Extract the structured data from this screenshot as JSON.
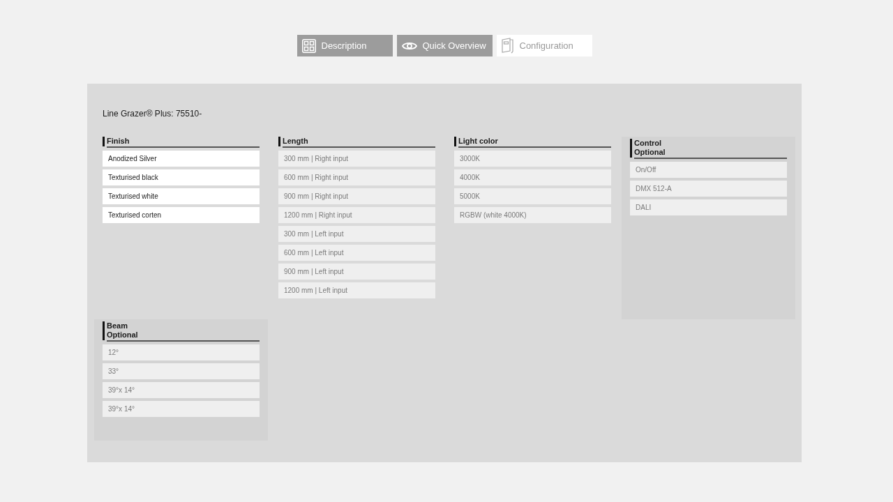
{
  "tabs": [
    {
      "label": "Description",
      "selected": false
    },
    {
      "label": "Quick Overview",
      "selected": false
    },
    {
      "label": "Configuration",
      "selected": true
    }
  ],
  "configurator": {
    "title": "Line Grazer® Plus: 75510-",
    "groups": [
      {
        "title": "Finish",
        "optional": false,
        "options": [
          {
            "label": "Anodized Silver",
            "disabled": false
          },
          {
            "label": "Texturised black",
            "disabled": false
          },
          {
            "label": "Texturised white",
            "disabled": false
          },
          {
            "label": "Texturised corten",
            "disabled": false
          }
        ]
      },
      {
        "title": "Length",
        "optional": false,
        "options": [
          {
            "label": "300 mm | Right input",
            "disabled": true
          },
          {
            "label": "600 mm | Right input",
            "disabled": true
          },
          {
            "label": "900 mm | Right input",
            "disabled": true
          },
          {
            "label": "1200 mm | Right input",
            "disabled": true
          },
          {
            "label": "300 mm | Left input",
            "disabled": true
          },
          {
            "label": "600 mm | Left input",
            "disabled": true
          },
          {
            "label": "900 mm | Left input",
            "disabled": true
          },
          {
            "label": "1200 mm | Left input",
            "disabled": true
          }
        ]
      },
      {
        "title": "Light color",
        "optional": false,
        "options": [
          {
            "label": "3000K",
            "disabled": true
          },
          {
            "label": "4000K",
            "disabled": true
          },
          {
            "label": "5000K",
            "disabled": true
          },
          {
            "label": "RGBW (white 4000K)",
            "disabled": true
          }
        ]
      },
      {
        "title": "Control",
        "subtitle": "Optional",
        "optional": true,
        "options": [
          {
            "label": "On/Off",
            "disabled": true
          },
          {
            "label": "DMX 512-A",
            "disabled": true
          },
          {
            "label": "DALI",
            "disabled": true
          }
        ]
      },
      {
        "title": "Beam",
        "subtitle": "Optional",
        "optional": true,
        "options": [
          {
            "label": "12°",
            "disabled": true
          },
          {
            "label": "33°",
            "disabled": true
          },
          {
            "label": "39°x 14°",
            "disabled": true
          },
          {
            "label": "39°x 14°",
            "disabled": true
          }
        ]
      }
    ]
  }
}
